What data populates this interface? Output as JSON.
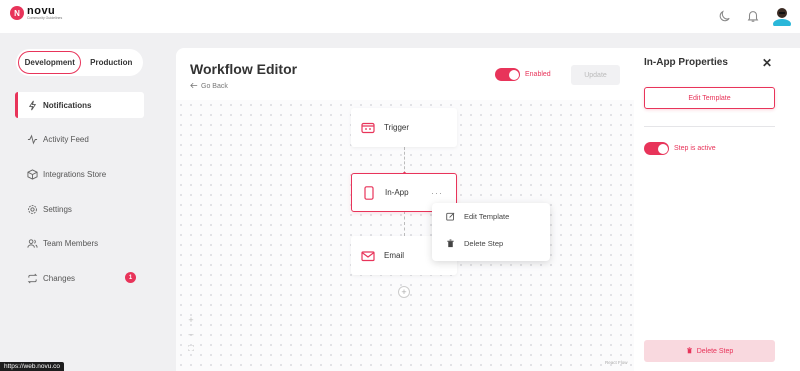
{
  "app": {
    "logo_letter": "N",
    "logo_name": "novu",
    "logo_tagline": "Community Guidelines"
  },
  "topbar": {
    "theme_icon": "moon-icon",
    "notifications_icon": "bell-icon",
    "avatar_icon": "avatar-icon"
  },
  "environment": {
    "development_label": "Development",
    "production_label": "Production",
    "selected": "Development"
  },
  "sidebar": {
    "items": [
      {
        "label": "Notifications",
        "icon": "bolt-icon",
        "active": true
      },
      {
        "label": "Activity Feed",
        "icon": "activity-icon",
        "active": false
      },
      {
        "label": "Integrations Store",
        "icon": "box-icon",
        "active": false
      },
      {
        "label": "Settings",
        "icon": "gear-icon",
        "active": false
      },
      {
        "label": "Team Members",
        "icon": "users-icon",
        "active": false
      },
      {
        "label": "Changes",
        "icon": "repeat-icon",
        "active": false,
        "badge": "1"
      }
    ]
  },
  "status_url": "https://web.novu.co",
  "editor": {
    "title": "Workflow Editor",
    "go_back_label": "Go Back",
    "enabled_label": "Enabled",
    "enabled": true,
    "update_label": "Update",
    "nodes": [
      {
        "label": "Trigger",
        "icon": "trigger-icon"
      },
      {
        "label": "In-App",
        "icon": "mobile-icon",
        "selected": true,
        "menu_dots": "···"
      },
      {
        "label": "Email",
        "icon": "mail-icon"
      }
    ],
    "add_node_label": "+",
    "context_menu": {
      "edit_label": "Edit Template",
      "delete_label": "Delete Step"
    },
    "zoom": {
      "in_label": "+",
      "out_label": "–",
      "fit_label": "⛶"
    },
    "watermark": "React Flow"
  },
  "properties_panel": {
    "title": "In-App Properties",
    "close_label": "✕",
    "edit_template_label": "Edit Template",
    "step_active_label": "Step is active",
    "step_active": true,
    "delete_step_label": "Delete Step"
  },
  "colors": {
    "accent": "#e8345a",
    "background": "#f0f0f2"
  }
}
